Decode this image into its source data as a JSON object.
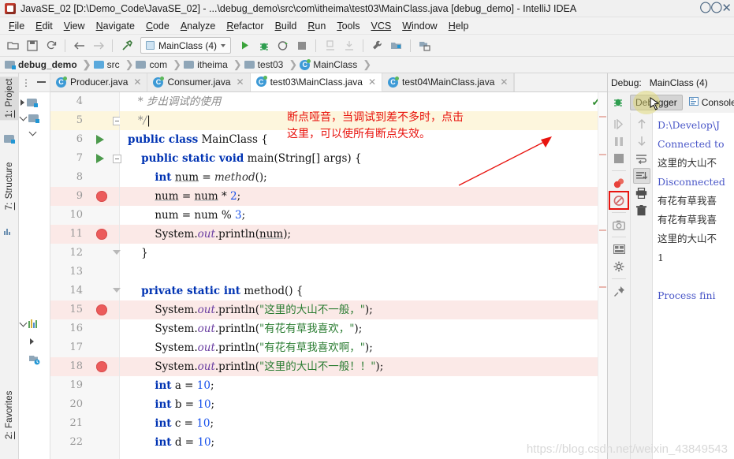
{
  "window": {
    "title": "JavaSE_02 [D:\\Demo_Code\\JavaSE_02] - ...\\debug_demo\\src\\com\\itheima\\test03\\MainClass.java [debug_demo] - IntelliJ IDEA",
    "app_icon": "intellij-idea-icon"
  },
  "menu": {
    "items": [
      {
        "mnemonic": "F",
        "rest": "ile"
      },
      {
        "mnemonic": "E",
        "rest": "dit"
      },
      {
        "mnemonic": "V",
        "rest": "iew"
      },
      {
        "mnemonic": "N",
        "rest": "avigate"
      },
      {
        "mnemonic": "C",
        "rest": "ode"
      },
      {
        "mnemonic": "A",
        "rest": "nalyze"
      },
      {
        "mnemonic": "R",
        "rest": "efactor"
      },
      {
        "mnemonic": "B",
        "rest": "uild"
      },
      {
        "mnemonic": "R",
        "rest": "un"
      },
      {
        "mnemonic": "T",
        "rest": "ools"
      },
      {
        "mnemonic": "VCS",
        "rest": ""
      },
      {
        "mnemonic": "W",
        "rest": "indow"
      },
      {
        "mnemonic": "H",
        "rest": "elp"
      }
    ]
  },
  "toolbar": {
    "run_config": "MainClass (4)",
    "buttons": [
      "open-folder-icon",
      "save-all-icon",
      "sync-icon",
      "back-arrow-icon",
      "forward-arrow-icon",
      "build-hammer-icon",
      "run-icon",
      "debug-icon",
      "run-with-coverage-icon",
      "stop-icon",
      "attach-profiler-icon",
      "attach-debugger-icon",
      "settings-wrench-icon",
      "project-structure-icon",
      "update-project-icon"
    ]
  },
  "breadcrumb": {
    "items": [
      {
        "label": "debug_demo",
        "icon": "module-folder-icon",
        "bold": true
      },
      {
        "label": "src",
        "icon": "source-folder-icon",
        "bold": false
      },
      {
        "label": "com",
        "icon": "package-folder-icon",
        "bold": false
      },
      {
        "label": "itheima",
        "icon": "package-folder-icon",
        "bold": false
      },
      {
        "label": "test03",
        "icon": "package-folder-icon",
        "bold": false
      },
      {
        "label": "MainClass",
        "icon": "java-class-icon",
        "bold": false
      }
    ]
  },
  "left_rail": {
    "items": [
      {
        "num": "1:",
        "label": " Project",
        "selected": true
      },
      {
        "num": "7:",
        "label": " Structure",
        "selected": false
      },
      {
        "num": "2:",
        "label": " Favorites",
        "selected": false
      }
    ]
  },
  "editor_tabs": [
    {
      "label": "Producer.java",
      "icon": "java-class-icon",
      "active": false
    },
    {
      "label": "Consumer.java",
      "icon": "java-class-icon",
      "active": false
    },
    {
      "label": "test03\\MainClass.java",
      "icon": "java-class-runnable-icon",
      "active": true
    },
    {
      "label": "test04\\MainClass.java",
      "icon": "java-class-runnable-icon",
      "active": false
    }
  ],
  "code": {
    "lines": [
      {
        "n": "4",
        "breakpoint": false,
        "runmark": false,
        "fold": "",
        "highlight": "",
        "html": "   <span class='cmt'>* 步出调试的使用</span>"
      },
      {
        "n": "5",
        "breakpoint": false,
        "runmark": false,
        "fold": "minus",
        "highlight": "caret",
        "html": "   <span class='cmt'>*/</span><span class='caretbar'>|</span>"
      },
      {
        "n": "6",
        "breakpoint": false,
        "runmark": true,
        "fold": "",
        "highlight": "",
        "html": "<span class='kw'>public class</span> MainClass {"
      },
      {
        "n": "7",
        "breakpoint": false,
        "runmark": true,
        "fold": "minus",
        "highlight": "",
        "html": "    <span class='kw'>public static void</span> main(String[] args) {"
      },
      {
        "n": "8",
        "breakpoint": false,
        "runmark": false,
        "fold": "",
        "highlight": "",
        "html": "        <span class='kw'>int</span> <span class='und'>num</span> = <span class='mtd'>method</span>();"
      },
      {
        "n": "9",
        "breakpoint": true,
        "runmark": false,
        "fold": "",
        "highlight": "bp",
        "html": "        <span class='und'>num</span> = <span class='und'>num</span> * <span class='num'>2</span>;"
      },
      {
        "n": "10",
        "breakpoint": false,
        "runmark": false,
        "fold": "",
        "highlight": "",
        "html": "        num = num % <span class='num'>3</span>;"
      },
      {
        "n": "11",
        "breakpoint": true,
        "runmark": false,
        "fold": "",
        "highlight": "bp",
        "html": "        System.<span class='fld'>out</span>.println(<span class='und'>num</span>);"
      },
      {
        "n": "12",
        "breakpoint": false,
        "runmark": false,
        "fold": "tri",
        "highlight": "",
        "html": "    }"
      },
      {
        "n": "13",
        "breakpoint": false,
        "runmark": false,
        "fold": "",
        "highlight": "",
        "html": ""
      },
      {
        "n": "14",
        "breakpoint": false,
        "runmark": false,
        "fold": "tri",
        "highlight": "",
        "html": "    <span class='kw'>private static int</span> method() {"
      },
      {
        "n": "15",
        "breakpoint": true,
        "runmark": false,
        "fold": "",
        "highlight": "bp",
        "html": "        System.<span class='fld'>out</span>.println(<span class='str'>\"这里的大山不一般，\"</span>);"
      },
      {
        "n": "16",
        "breakpoint": false,
        "runmark": false,
        "fold": "",
        "highlight": "",
        "html": "        System.<span class='fld'>out</span>.println(<span class='str'>\"有花有草我喜欢，\"</span>);"
      },
      {
        "n": "17",
        "breakpoint": false,
        "runmark": false,
        "fold": "",
        "highlight": "",
        "html": "        System.<span class='fld'>out</span>.println(<span class='str'>\"有花有草我喜欢啊，\"</span>);"
      },
      {
        "n": "18",
        "breakpoint": true,
        "runmark": false,
        "fold": "",
        "highlight": "bp",
        "html": "        System.<span class='fld'>out</span>.println(<span class='str'>\"这里的大山不一般！！\"</span>);"
      },
      {
        "n": "19",
        "breakpoint": false,
        "runmark": false,
        "fold": "",
        "highlight": "",
        "html": "        <span class='kw'>int</span> a = <span class='num'>10</span>;"
      },
      {
        "n": "20",
        "breakpoint": false,
        "runmark": false,
        "fold": "",
        "highlight": "",
        "html": "        <span class='kw'>int</span> b = <span class='num'>10</span>;"
      },
      {
        "n": "21",
        "breakpoint": false,
        "runmark": false,
        "fold": "",
        "highlight": "",
        "html": "        <span class='kw'>int</span> c = <span class='num'>10</span>;"
      },
      {
        "n": "22",
        "breakpoint": false,
        "runmark": false,
        "fold": "",
        "highlight": "",
        "html": "        <span class='kw'>int</span> d = <span class='num'>10</span>;"
      }
    ],
    "inspection_status": "ok-checkmark"
  },
  "annotation": {
    "line1": "断点哑音，当调试到差不多时，点击",
    "line2": "这里，可以使所有断点失效。",
    "color": "#e8140f"
  },
  "debug_panel": {
    "header_label": "Debug:",
    "header_config": "MainClass (4)",
    "tabs": [
      {
        "label": "Debugger",
        "icon": "debugger-icon",
        "selected": true
      },
      {
        "label": "Console",
        "icon": "console-icon",
        "selected": false
      }
    ],
    "side_icons": [
      "debug-bug-icon",
      "resume-program-icon",
      "pause-program-icon",
      "stop-program-icon",
      "view-breakpoints-icon",
      "mute-breakpoints-icon",
      "screenshot-icon",
      "layout-settings-icon",
      "settings-gear-icon",
      "pin-tab-icon"
    ],
    "console_icons": [
      "scroll-up-icon",
      "scroll-down-icon",
      "soft-wrap-icon",
      "scroll-to-end-icon",
      "print-icon",
      "clear-all-icon"
    ],
    "highlighted_icon": "mute-breakpoints-icon",
    "console_lines": [
      {
        "text": "D:\\Develop\\J",
        "blue": true
      },
      {
        "text": "Connected to",
        "blue": true
      },
      {
        "text": "这里的大山不",
        "blue": false
      },
      {
        "text": "Disconnected",
        "blue": true
      },
      {
        "text": "有花有草我喜",
        "blue": false
      },
      {
        "text": "有花有草我喜",
        "blue": false
      },
      {
        "text": "这里的大山不",
        "blue": false
      },
      {
        "text": "1",
        "blue": false
      },
      {
        "text": "",
        "blue": false
      },
      {
        "text": "Process fini",
        "blue": true
      }
    ]
  },
  "watermark": "https://blog.csdn.net/weixin_43849543"
}
